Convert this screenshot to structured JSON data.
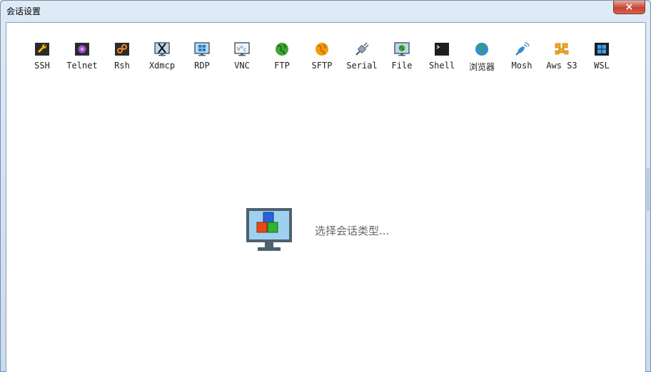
{
  "window": {
    "title": "会话设置",
    "close_glyph": "×"
  },
  "toolbar": {
    "items": [
      {
        "label": "SSH",
        "icon": "wrench-icon"
      },
      {
        "label": "Telnet",
        "icon": "telnet-icon"
      },
      {
        "label": "Rsh",
        "icon": "rsh-icon"
      },
      {
        "label": "Xdmcp",
        "icon": "xdmcp-icon"
      },
      {
        "label": "RDP",
        "icon": "rdp-icon"
      },
      {
        "label": "VNC",
        "icon": "vnc-icon"
      },
      {
        "label": "FTP",
        "icon": "ftp-globe-icon"
      },
      {
        "label": "SFTP",
        "icon": "sftp-globe-icon"
      },
      {
        "label": "Serial",
        "icon": "serial-plug-icon"
      },
      {
        "label": "File",
        "icon": "file-monitor-icon"
      },
      {
        "label": "Shell",
        "icon": "shell-terminal-icon"
      },
      {
        "label": "浏览器",
        "icon": "browser-globe-icon"
      },
      {
        "label": "Mosh",
        "icon": "mosh-satellite-icon"
      },
      {
        "label": "Aws S3",
        "icon": "aws-s3-icon"
      },
      {
        "label": "WSL",
        "icon": "wsl-windows-icon"
      }
    ]
  },
  "main": {
    "hint": "选择会话类型..."
  },
  "colors": {
    "window_frame": "#c9dbf0",
    "close_button": "#c7432f",
    "hint_text": "#666666",
    "monitor_frame": "#4d6170",
    "monitor_screen": "#9fd1ef"
  }
}
